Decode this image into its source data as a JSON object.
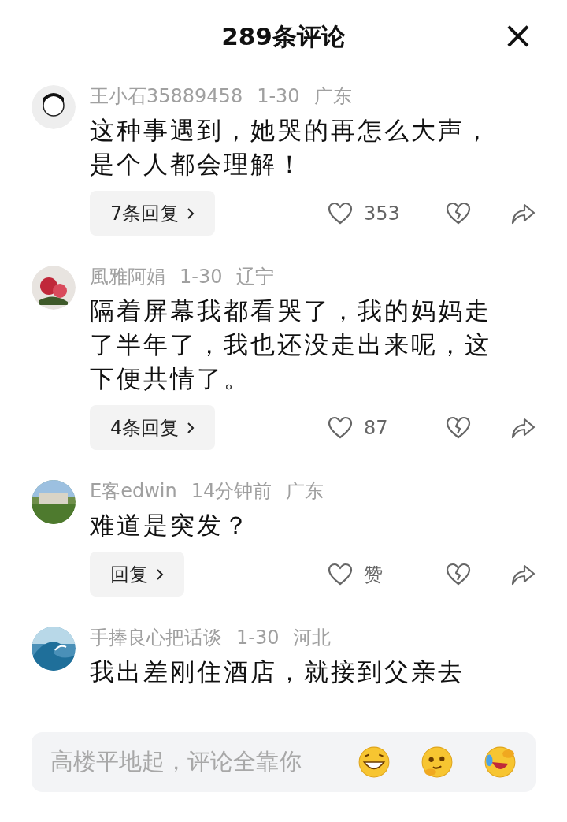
{
  "header": {
    "title": "289条评论",
    "close": "×"
  },
  "comments": [
    {
      "user": "王小石35889458",
      "date": "1-30",
      "region": "广东",
      "text": "这种事遇到，她哭的再怎么大声，是个人都会理解！",
      "replies": "7条回复",
      "likes": "353"
    },
    {
      "user": "風雅阿娟",
      "date": "1-30",
      "region": "辽宁",
      "text": "隔着屏幕我都看哭了，我的妈妈走了半年了，我也还没走出来呢，这下便共情了。",
      "replies": "4条回复",
      "likes": "87"
    },
    {
      "user": "E客edwin",
      "date": "14分钟前",
      "region": "广东",
      "text": "难道是突发？",
      "replies": "回复",
      "likes": "赞"
    },
    {
      "user": "手捧良心把话谈",
      "date": "1-30",
      "region": "河北",
      "text": "我出差刚住酒店，就接到父亲去"
    }
  ],
  "input": {
    "placeholder": "高楼平地起，评论全靠你"
  }
}
